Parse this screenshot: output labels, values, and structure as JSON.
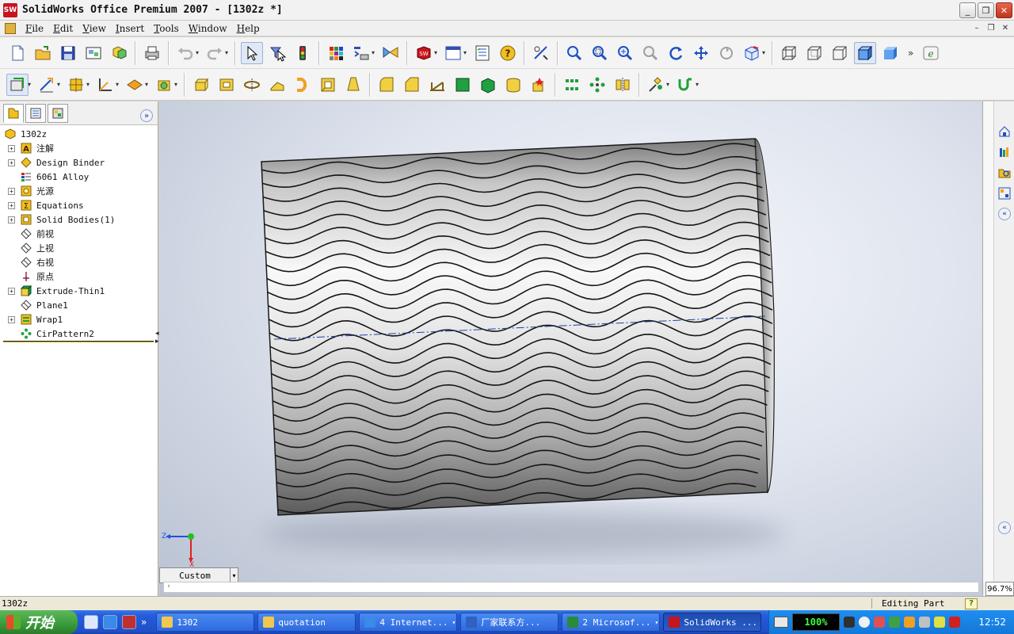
{
  "window": {
    "title": "SolidWorks Office Premium 2007 - [1302z *]",
    "app_icon": "SW"
  },
  "menu": {
    "items": [
      {
        "key": "F",
        "rest": "ile"
      },
      {
        "key": "E",
        "rest": "dit"
      },
      {
        "key": "V",
        "rest": "iew"
      },
      {
        "key": "I",
        "rest": "nsert"
      },
      {
        "key": "T",
        "rest": "ools"
      },
      {
        "key": "W",
        "rest": "indow"
      },
      {
        "key": "H",
        "rest": "elp"
      }
    ]
  },
  "feature_tree": {
    "root": "1302z",
    "nodes": [
      {
        "label": "注解",
        "icon": "annotations-icon",
        "expandable": true
      },
      {
        "label": "Design Binder",
        "icon": "design-binder-icon",
        "expandable": true
      },
      {
        "label": "6061 Alloy",
        "icon": "material-icon",
        "expandable": false
      },
      {
        "label": "光源",
        "icon": "lights-icon",
        "expandable": true
      },
      {
        "label": "Equations",
        "icon": "equations-icon",
        "expandable": true
      },
      {
        "label": "Solid Bodies(1)",
        "icon": "solid-bodies-icon",
        "expandable": true
      },
      {
        "label": "前视",
        "icon": "plane-icon",
        "expandable": false
      },
      {
        "label": "上视",
        "icon": "plane-icon",
        "expandable": false
      },
      {
        "label": "右视",
        "icon": "plane-icon",
        "expandable": false
      },
      {
        "label": "原点",
        "icon": "origin-icon",
        "expandable": false
      },
      {
        "label": "Extrude-Thin1",
        "icon": "extrude-icon",
        "expandable": true
      },
      {
        "label": "Plane1",
        "icon": "plane-icon",
        "expandable": false
      },
      {
        "label": "Wrap1",
        "icon": "wrap-icon",
        "expandable": true
      },
      {
        "label": "CirPattern2",
        "icon": "circular-pattern-icon",
        "expandable": false
      }
    ]
  },
  "viewport": {
    "view_orientation": "Custom",
    "triad_z_label": "Z",
    "triad_x_label": "X"
  },
  "taskpane": {
    "zoom": "96.7%"
  },
  "status": {
    "document": "1302z",
    "mode": "Editing Part",
    "help": "?"
  },
  "taskbar": {
    "start_label": "开始",
    "tasks": [
      {
        "label": "1302",
        "icon": "folder-icon",
        "color": "#f0c850"
      },
      {
        "label": "quotation",
        "icon": "folder-icon",
        "color": "#f0c850"
      },
      {
        "label": "4 Internet...",
        "icon": "ie-icon",
        "color": "#3a8ae8"
      },
      {
        "label": "厂家联系方...",
        "icon": "word-icon",
        "color": "#3060c0"
      },
      {
        "label": "2 Microsof...",
        "icon": "excel-icon",
        "color": "#2a8a3a"
      },
      {
        "label": "SolidWorks ...",
        "icon": "solidworks-icon",
        "color": "#c8141e"
      }
    ],
    "perf": "100%",
    "clock": "12:52"
  }
}
